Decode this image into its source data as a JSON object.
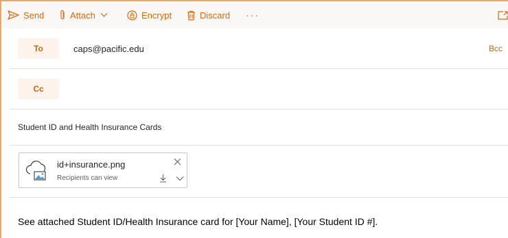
{
  "toolbar": {
    "send_label": "Send",
    "attach_label": "Attach",
    "encrypt_label": "Encrypt",
    "discard_label": "Discard",
    "more_label": "···"
  },
  "recipients": {
    "to_label": "To",
    "to_value": "caps@pacific.edu",
    "bcc_label": "Bcc",
    "cc_label": "Cc"
  },
  "subject": "Student ID and Health Insurance Cards",
  "attachment": {
    "file_name": "id+insurance.png",
    "permission": "Recipients can view"
  },
  "body": "See attached Student ID/Health Insurance card for [Your Name], [Your Student ID #].",
  "colors": {
    "accent": "#d86a0b",
    "pill_bg": "#fdf3ea",
    "frame_border": "#e9a760"
  }
}
